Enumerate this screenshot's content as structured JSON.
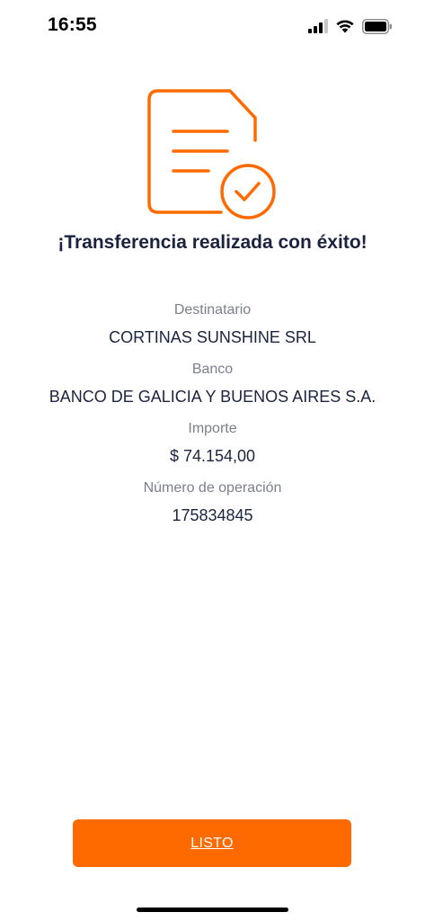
{
  "status_bar": {
    "time": "16:55",
    "icons": [
      "signal-icon",
      "wifi-icon",
      "battery-icon"
    ]
  },
  "hero": {
    "icon": "document-check-icon",
    "accent_color": "#ff6a00"
  },
  "title": "¡Transferencia realizada con éxito!",
  "details": [
    {
      "label": "Destinatario",
      "value": "CORTINAS SUNSHINE SRL"
    },
    {
      "label": "Banco",
      "value": "BANCO DE GALICIA Y BUENOS AIRES S.A."
    },
    {
      "label": "Importe",
      "value": "$ 74.154,00"
    },
    {
      "label": "Número de operación",
      "value": "175834845"
    }
  ],
  "button": {
    "label": "LISTO",
    "color": "#ff6a00"
  }
}
